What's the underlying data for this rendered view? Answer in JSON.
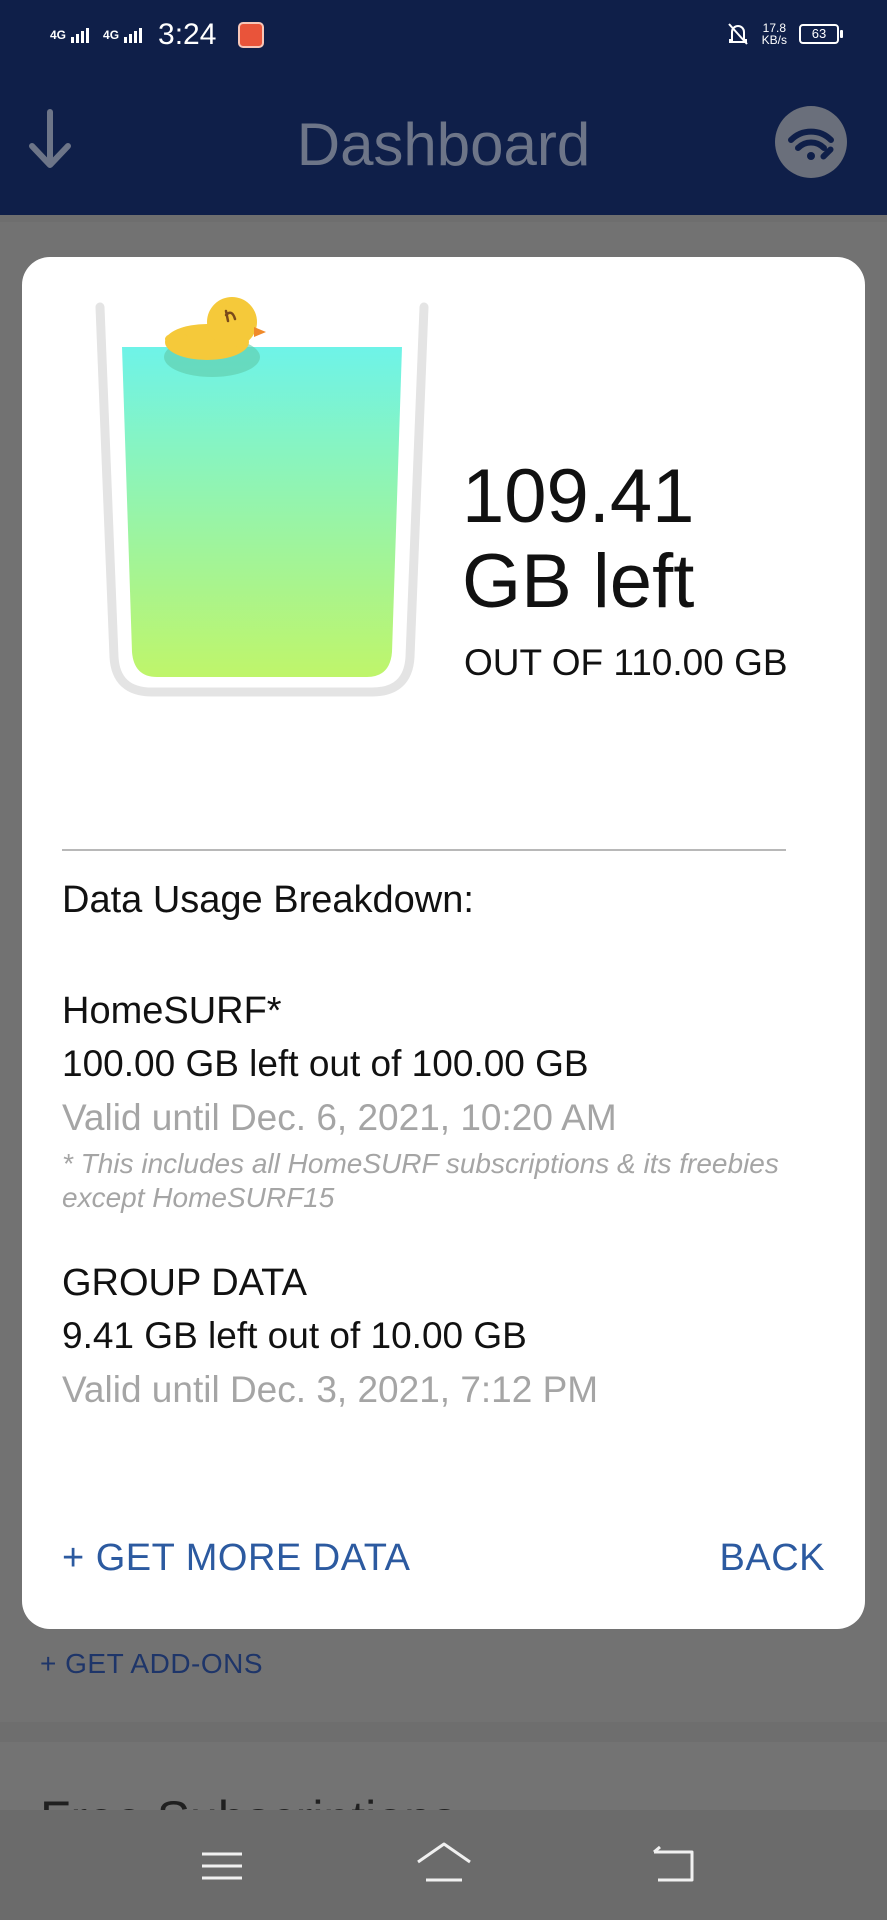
{
  "status_bar": {
    "network_1": "4G",
    "network_2": "4G",
    "time": "3:24",
    "speed_value": "17.8",
    "speed_unit": "KB/s",
    "battery": "63"
  },
  "app_bar": {
    "title": "Dashboard"
  },
  "background": {
    "add_ons_link": "+ GET ADD-ONS",
    "free_section_title": "Free Subscriptions"
  },
  "dialog": {
    "remaining_value": "109.41",
    "remaining_unit": "GB left",
    "total_text": "OUT OF 110.00 GB",
    "fill_fraction": 0.995,
    "breakdown_title": "Data Usage Breakdown:",
    "items": [
      {
        "name": "HomeSURF*",
        "amount": "100.00 GB left out of 100.00 GB",
        "valid": "Valid until Dec. 6, 2021, 10:20 AM",
        "note": "* This includes all HomeSURF subscriptions & its freebies except HomeSURF15"
      },
      {
        "name": "GROUP DATA",
        "amount": "9.41 GB left out of 10.00 GB",
        "valid": "Valid until Dec. 3, 2021, 7:12 PM"
      }
    ],
    "get_more_label": "+ GET MORE DATA",
    "back_label": "BACK"
  },
  "colors": {
    "header": "#0f1f49",
    "accent": "#2c5aa0",
    "water_top": "#6ef3e8",
    "water_bottom": "#bff56a",
    "duck": "#f5c93a"
  },
  "icons": {
    "back": "download-arrow-icon",
    "wifi": "wifi-tool-icon",
    "mute": "bell-off-icon",
    "nav_menu": "menu-icon",
    "nav_home": "home-icon",
    "nav_back": "back-icon"
  }
}
